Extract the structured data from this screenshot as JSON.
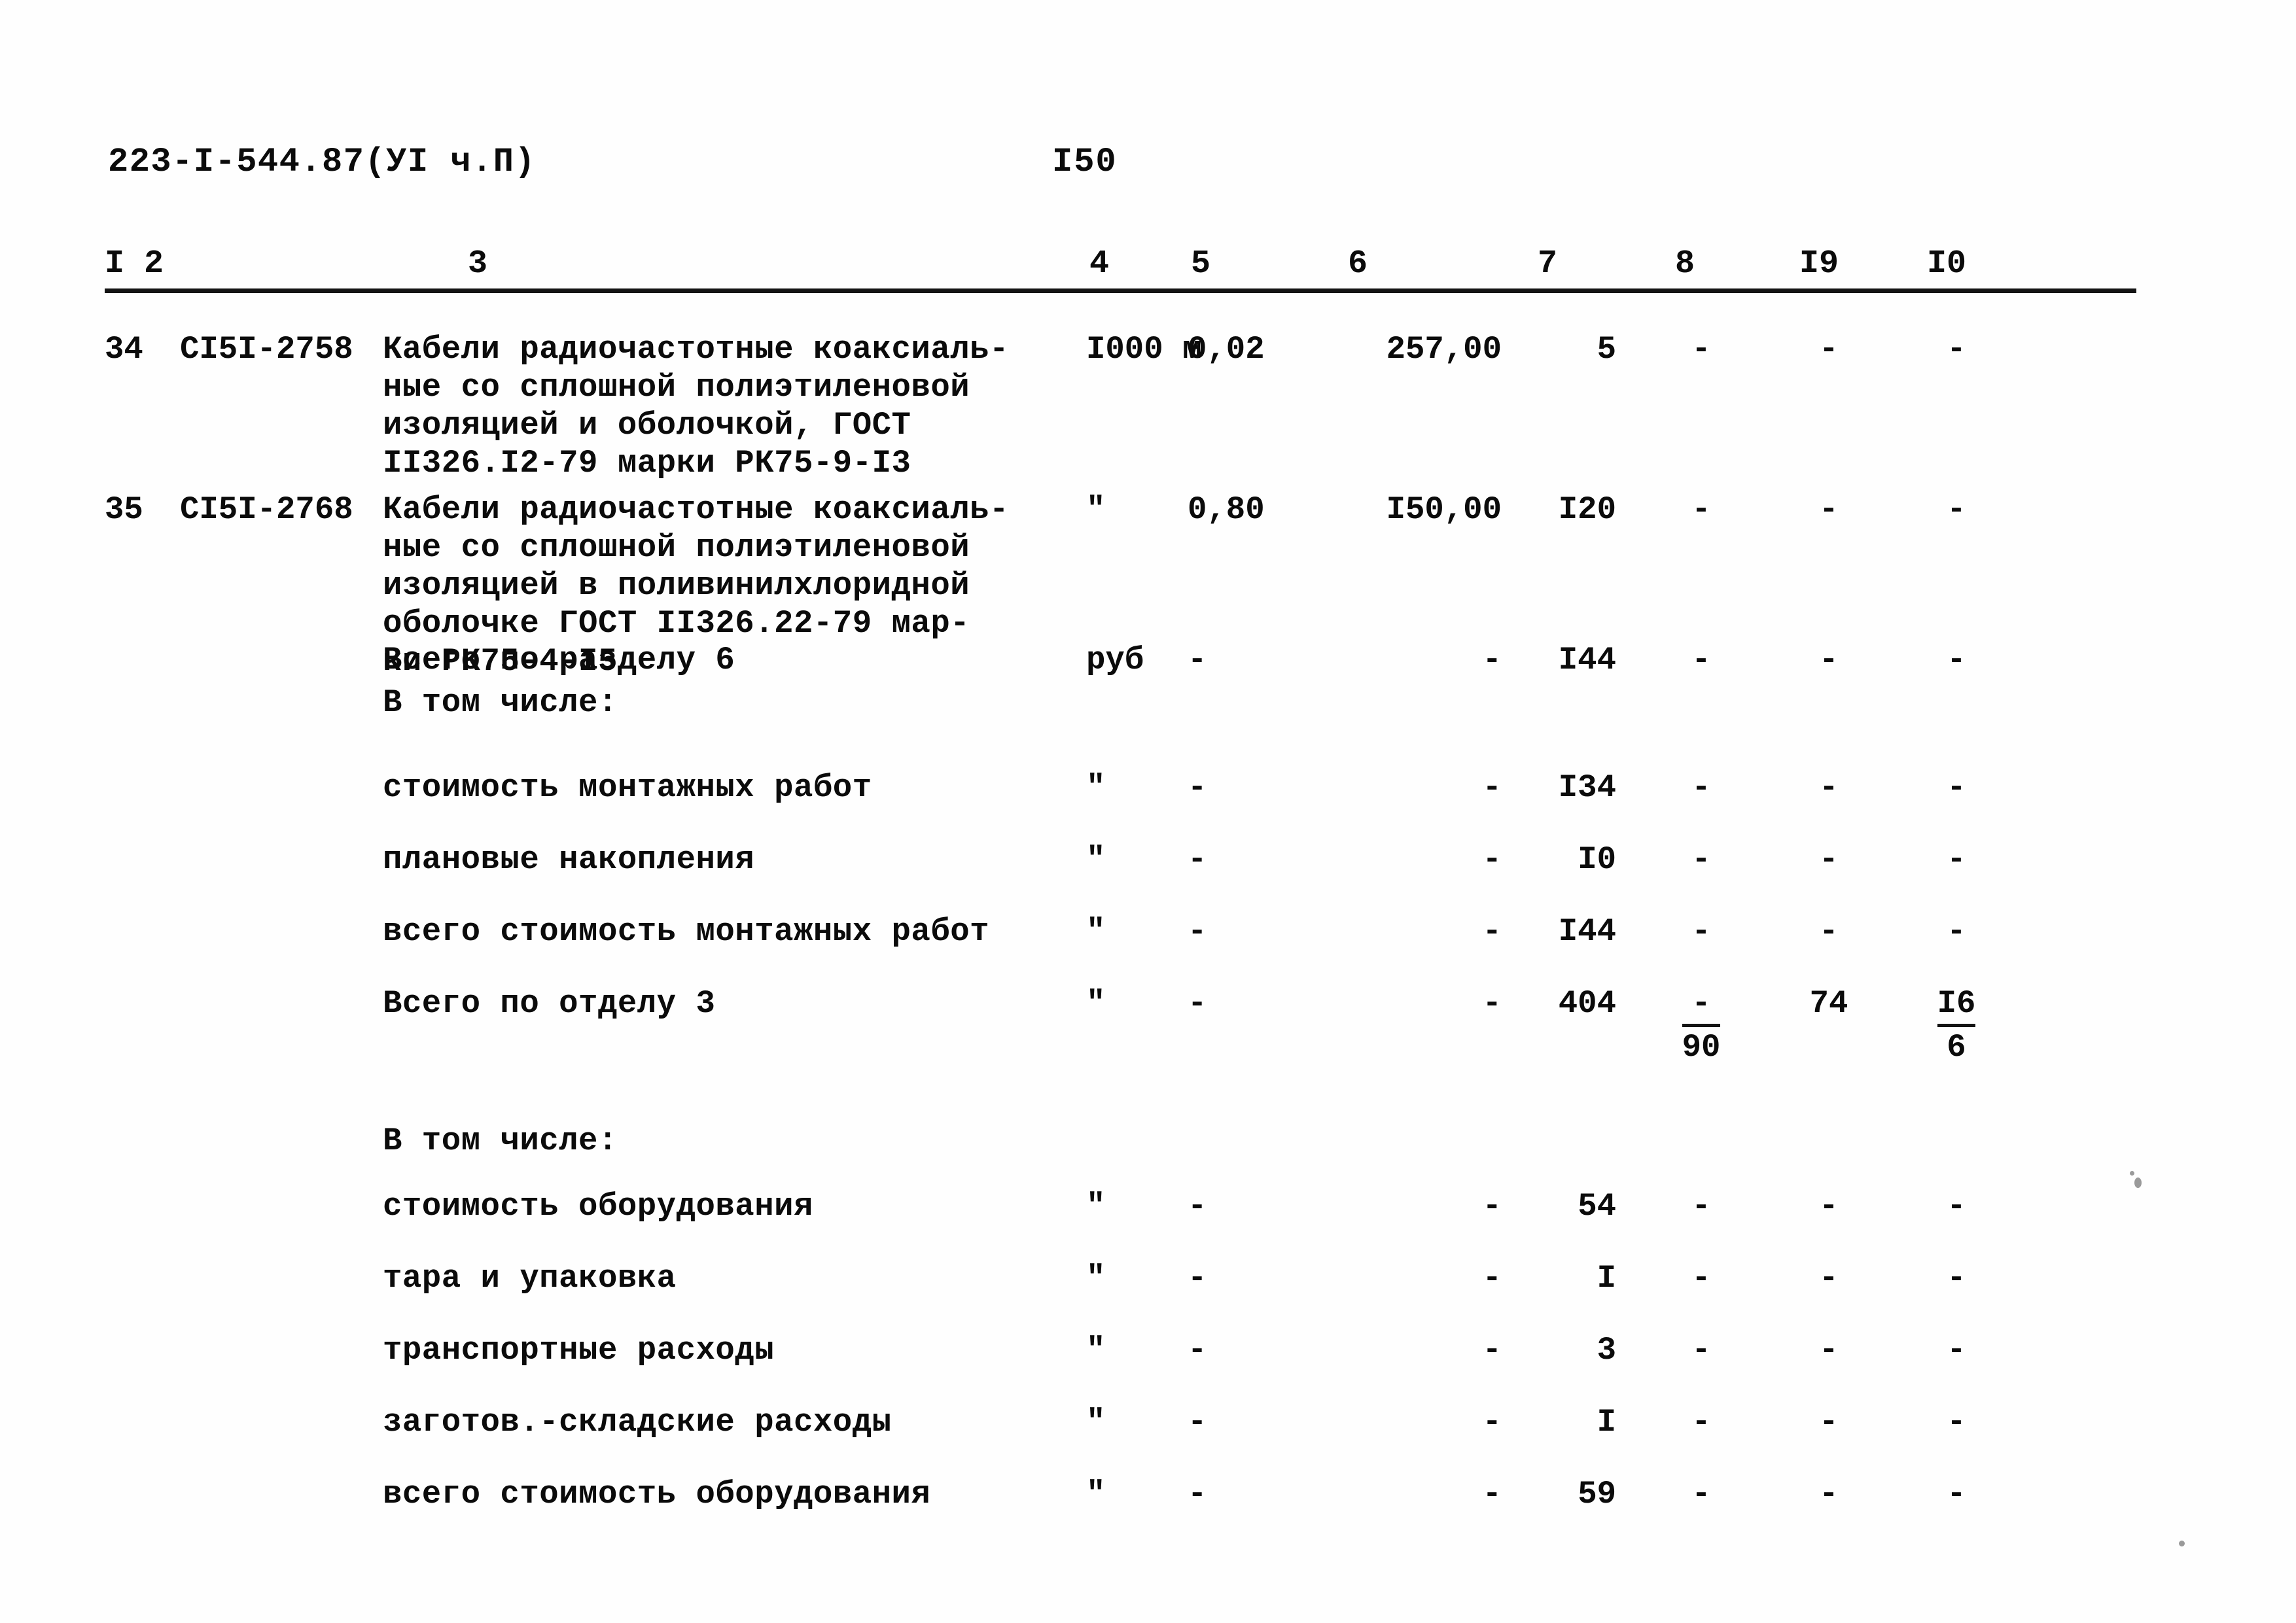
{
  "document": {
    "header_code": "223-I-544.87(УI ч.П)",
    "page_number": "I50"
  },
  "table": {
    "column_headers": [
      "I",
      "2",
      "3",
      "4",
      "5",
      "6",
      "7",
      "8",
      "I9",
      "I0"
    ],
    "rows": [
      {
        "num": "34",
        "code": "СI5I-2758",
        "description": "Кабели радиочастотные коаксиаль-\nные со сплошной полиэтиленовой\nизоляцией и оболочкой, ГОСТ\nII326.I2-79 марки РК75-9-I3",
        "unit": "I000\nм",
        "c5": "0,02",
        "c6": "257,00",
        "c7": "5",
        "c8": "-",
        "c19": "-",
        "c10": "-"
      },
      {
        "num": "35",
        "code": "СI5I-2768",
        "description": "Кабели радиочастотные коаксиаль-\nные со сплошной полиэтиленовой\nизоляцией в поливинилхлоридной\nоболочке ГОСТ II326.22-79 мар-\nки РК75-4-I5",
        "unit": "\"",
        "c5": "0,80",
        "c6": "I50,00",
        "c7": "I20",
        "c8": "-",
        "c19": "-",
        "c10": "-"
      },
      {
        "num": "",
        "code": "",
        "description": "Всего по разделу 6",
        "unit": "руб",
        "c5": "-",
        "c6": "-",
        "c7": "I44",
        "c8": "-",
        "c19": "-",
        "c10": "-"
      },
      {
        "num": "",
        "code": "",
        "description": "В том числе:",
        "unit": "",
        "c5": "",
        "c6": "",
        "c7": "",
        "c8": "",
        "c19": "",
        "c10": ""
      },
      {
        "num": "",
        "code": "",
        "description": "стоимость монтажных работ",
        "unit": "\"",
        "c5": "-",
        "c6": "-",
        "c7": "I34",
        "c8": "-",
        "c19": "-",
        "c10": "-"
      },
      {
        "num": "",
        "code": "",
        "description": "плановые накопления",
        "unit": "\"",
        "c5": "-",
        "c6": "-",
        "c7": "I0",
        "c8": "-",
        "c19": "-",
        "c10": "-"
      },
      {
        "num": "",
        "code": "",
        "description": "всего стоимость монтажных работ",
        "unit": "\"",
        "c5": "-",
        "c6": "-",
        "c7": "I44",
        "c8": "-",
        "c19": "-",
        "c10": "-"
      },
      {
        "num": "",
        "code": "",
        "description": "Всего по отделу 3",
        "unit": "\"",
        "c5": "-",
        "c6": "-",
        "c7": "404",
        "c8": {
          "numerator": "-",
          "denominator": "90"
        },
        "c19": "74",
        "c10": {
          "numerator": "I6",
          "denominator": "6"
        }
      },
      {
        "num": "",
        "code": "",
        "description": "В том числе:",
        "unit": "",
        "c5": "",
        "c6": "",
        "c7": "",
        "c8": "",
        "c19": "",
        "c10": ""
      },
      {
        "num": "",
        "code": "",
        "description": "стоимость оборудования",
        "unit": "\"",
        "c5": "-",
        "c6": "-",
        "c7": "54",
        "c8": "-",
        "c19": "-",
        "c10": "-"
      },
      {
        "num": "",
        "code": "",
        "description": "тара и упаковка",
        "unit": "\"",
        "c5": "-",
        "c6": "-",
        "c7": "I",
        "c8": "-",
        "c19": "-",
        "c10": "-"
      },
      {
        "num": "",
        "code": "",
        "description": "транспортные расходы",
        "unit": "\"",
        "c5": "-",
        "c6": "-",
        "c7": "3",
        "c8": "-",
        "c19": "-",
        "c10": "-"
      },
      {
        "num": "",
        "code": "",
        "description": "заготов.-складские расходы",
        "unit": "\"",
        "c5": "-",
        "c6": "-",
        "c7": "I",
        "c8": "-",
        "c19": "-",
        "c10": "-"
      },
      {
        "num": "",
        "code": "",
        "description": "всего стоимость оборудования",
        "unit": "\"",
        "c5": "-",
        "c6": "-",
        "c7": "59",
        "c8": "-",
        "c19": "-",
        "c10": "-"
      }
    ]
  },
  "layout": {
    "header_x_positions": [
      0,
      60,
      555,
      1505,
      1660,
      1900,
      2190,
      2400,
      2590,
      2785
    ],
    "row_tops": [
      40,
      285,
      515,
      580,
      710,
      820,
      930,
      1040,
      1250,
      1350,
      1460,
      1570,
      1680,
      1790
    ]
  },
  "colors": {
    "ink": "#0b0b0b",
    "paper": "#fefefe",
    "rule": "#141414"
  }
}
